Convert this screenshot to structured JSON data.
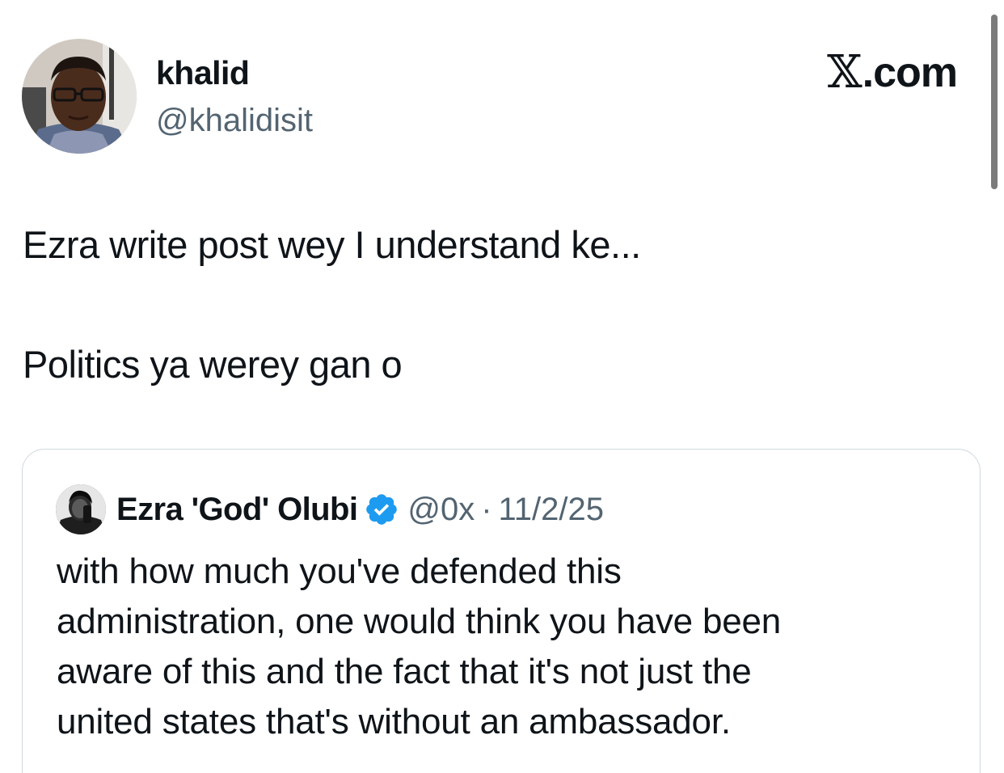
{
  "post": {
    "author": {
      "name": "khalid",
      "handle": "@khalidisit",
      "avatar_icon": "profile-photo"
    },
    "brand": {
      "mark": "𝕏",
      "suffix": ".com"
    },
    "text_lines": [
      "Ezra write post wey I understand ke...",
      "Politics ya werey gan o"
    ]
  },
  "quoted_post": {
    "author": {
      "name": "Ezra 'God' Olubi",
      "handle": "@0x",
      "verified": true,
      "avatar_icon": "profile-photo"
    },
    "separator": "·",
    "date": "11/2/25",
    "text_lines": [
      "with how much you've defended this",
      "administration, one would think you have been",
      "aware of this and the fact that it's not just the",
      "united states that's without an ambassador."
    ]
  },
  "colors": {
    "text_primary": "#0f1419",
    "text_secondary": "#536471",
    "border": "#cfd9de",
    "verified_blue": "#1d9bf0"
  }
}
